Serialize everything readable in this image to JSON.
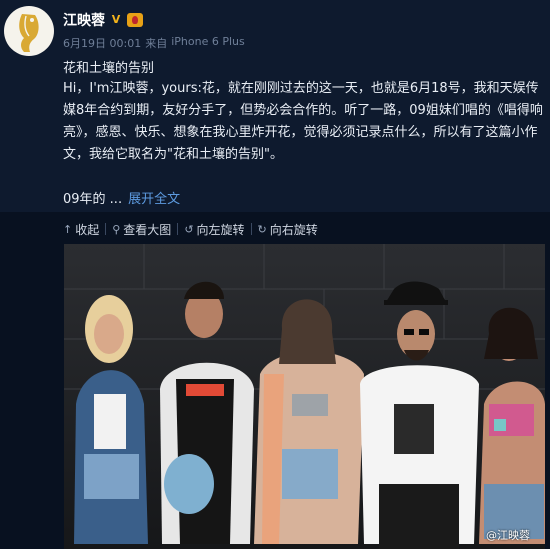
{
  "user": {
    "name": "江映蓉",
    "verified_icon": "verified-v-icon",
    "badge_icon": "member-badge-icon"
  },
  "post": {
    "time": "6月19日 00:01",
    "source_prefix": "来自",
    "source": "iPhone 6 Plus",
    "title": "花和土壤的告别",
    "body": "Hi，I'm江映蓉，yours:花，就在刚刚过去的这一天，也就是6月18号，我和天娱传媒8年合约到期，友好分手了，但势必会合作的。听了一路，09姐妹们唱的《唱得响亮》，感恩、快乐、想象在我心里炸开花，觉得必须记录点什么，所以有了这篇小作文，我给它取名为\"花和土壤的告别\"。",
    "excerpt_end": "09年的 ...",
    "expand_label": "展开全文"
  },
  "toolbar": {
    "collapse": "收起",
    "view_large": "查看大图",
    "rotate_left": "向左旋转",
    "rotate_right": "向右旋转"
  },
  "photo": {
    "watermark": "@江映蓉"
  },
  "colors": {
    "background": "#0e1a2e",
    "link": "#5d9be0",
    "badge": "#f3b31b"
  }
}
